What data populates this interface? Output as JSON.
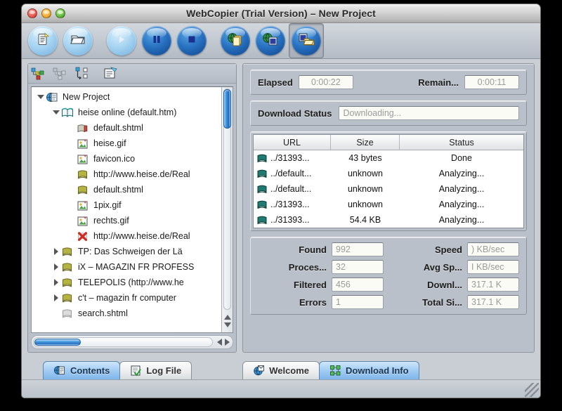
{
  "window": {
    "title": "WebCopier (Trial Version) – New Project",
    "controls": [
      {
        "name": "close",
        "icon": "close-button"
      },
      {
        "name": "minimize",
        "icon": "minimize-button"
      },
      {
        "name": "zoom",
        "icon": "zoom-button"
      }
    ]
  },
  "toolbar": {
    "buttons": [
      {
        "name": "new-project",
        "icon": "new-document-icon",
        "style": "light",
        "tooltip": "New Project"
      },
      {
        "name": "open-project",
        "icon": "open-folder-icon",
        "style": "light",
        "tooltip": "Open Project"
      },
      {
        "name": "start-download",
        "icon": "play-icon",
        "style": "light",
        "tooltip": "Start"
      },
      {
        "name": "pause-download",
        "icon": "pause-icon",
        "style": "dark",
        "tooltip": "Pause"
      },
      {
        "name": "stop-download",
        "icon": "stop-icon",
        "style": "dark",
        "tooltip": "Stop"
      },
      {
        "name": "copy-url",
        "icon": "globe-copy-icon",
        "style": "dark",
        "tooltip": "Copy URL"
      },
      {
        "name": "globe-window",
        "icon": "globe-window-icon",
        "style": "dark",
        "tooltip": "Browse"
      },
      {
        "name": "project-folder",
        "icon": "open-project-icon",
        "style": "dark",
        "tooltip": "Project Folder",
        "selected": true
      }
    ]
  },
  "tree_toolbar": {
    "buttons": [
      {
        "name": "expand-all",
        "icon": "expand-nodes-icon"
      },
      {
        "name": "collapse-all",
        "icon": "collapse-nodes-icon"
      },
      {
        "name": "refresh-tree",
        "icon": "refresh-tree-icon"
      },
      {
        "name": "item-properties",
        "icon": "properties-icon"
      }
    ]
  },
  "tree": {
    "rows": [
      {
        "indent": 0,
        "twisty": "open",
        "icon": "project-globe-icon",
        "label": "New Project"
      },
      {
        "indent": 1,
        "twisty": "open",
        "icon": "site-book-icon",
        "label": "heise online (default.htm)"
      },
      {
        "indent": 2,
        "twisty": "none",
        "icon": "page-red-icon",
        "label": "default.shtml"
      },
      {
        "indent": 2,
        "twisty": "none",
        "icon": "image-icon",
        "label": "heise.gif"
      },
      {
        "indent": 2,
        "twisty": "none",
        "icon": "image-icon",
        "label": "favicon.ico"
      },
      {
        "indent": 2,
        "twisty": "none",
        "icon": "book-olive-icon",
        "label": "http://www.heise.de/Real"
      },
      {
        "indent": 2,
        "twisty": "none",
        "icon": "book-olive-icon",
        "label": "default.shtml"
      },
      {
        "indent": 2,
        "twisty": "none",
        "icon": "image-icon",
        "label": "1pix.gif"
      },
      {
        "indent": 2,
        "twisty": "none",
        "icon": "image-icon",
        "label": "rechts.gif"
      },
      {
        "indent": 2,
        "twisty": "none",
        "icon": "error-x-icon",
        "label": "http://www.heise.de/Real"
      },
      {
        "indent": 1,
        "twisty": "closed",
        "icon": "book-olive-icon",
        "label": "TP: Das Schweigen der Lä"
      },
      {
        "indent": 1,
        "twisty": "closed",
        "icon": "book-olive-icon",
        "label": "iX – MAGAZIN FR PROFESS"
      },
      {
        "indent": 1,
        "twisty": "closed",
        "icon": "book-olive-icon",
        "label": "TELEPOLIS (http://www.he"
      },
      {
        "indent": 1,
        "twisty": "closed",
        "icon": "book-olive-icon",
        "label": "c't – magazin fr computer"
      },
      {
        "indent": 1,
        "twisty": "none",
        "icon": "book-grey-icon",
        "label": "search.shtml"
      }
    ]
  },
  "time_panel": {
    "elapsed_label": "Elapsed",
    "elapsed_value": "0:00:22",
    "remaining_label": "Remain...",
    "remaining_value": "0:00:11"
  },
  "status_panel": {
    "label": "Download Status",
    "value": "Downloading..."
  },
  "download_table": {
    "columns": [
      "URL",
      "Size",
      "Status"
    ],
    "rows": [
      {
        "icon": "book-teal-icon",
        "url": "../31393...",
        "size": "43 bytes",
        "status": "Done"
      },
      {
        "icon": "book-teal-icon",
        "url": "../default...",
        "size": "unknown",
        "status": "Analyzing..."
      },
      {
        "icon": "book-teal-icon",
        "url": "../default...",
        "size": "unknown",
        "status": "Analyzing..."
      },
      {
        "icon": "book-teal-icon",
        "url": "../31393...",
        "size": "unknown",
        "status": "Analyzing..."
      },
      {
        "icon": "book-teal-icon",
        "url": "../31393...",
        "size": "54.4 KB",
        "status": "Analyzing..."
      }
    ]
  },
  "stats": {
    "left": [
      {
        "label": "Found",
        "value": "992"
      },
      {
        "label": "Proces...",
        "value": "32"
      },
      {
        "label": "Filtered",
        "value": "456"
      },
      {
        "label": "Errors",
        "value": "1"
      }
    ],
    "right": [
      {
        "label": "Speed",
        "value": ") KB/sec"
      },
      {
        "label": "Avg Sp...",
        "value": "I KB/sec"
      },
      {
        "label": "Downl...",
        "value": "317.1 K"
      },
      {
        "label": "Total Si...",
        "value": "317.1 K"
      }
    ]
  },
  "tabs": {
    "left": [
      {
        "name": "tab-contents",
        "label": "Contents",
        "icon": "contents-globe-icon",
        "active": true
      },
      {
        "name": "tab-log-file",
        "label": "Log File",
        "icon": "log-file-icon",
        "active": false
      }
    ],
    "right": [
      {
        "name": "tab-welcome",
        "label": "Welcome",
        "icon": "welcome-globe-icon",
        "active": false
      },
      {
        "name": "tab-download-info",
        "label": "Download Info",
        "icon": "nodes-green-icon",
        "active": true
      }
    ]
  },
  "colors": {
    "accent_blue": "#2271c0",
    "window_chrome": "#c9ced5",
    "pane_bg": "#b9c0c9",
    "field_bg": "#fbfbf6",
    "tab_active": "#a5cef4"
  }
}
